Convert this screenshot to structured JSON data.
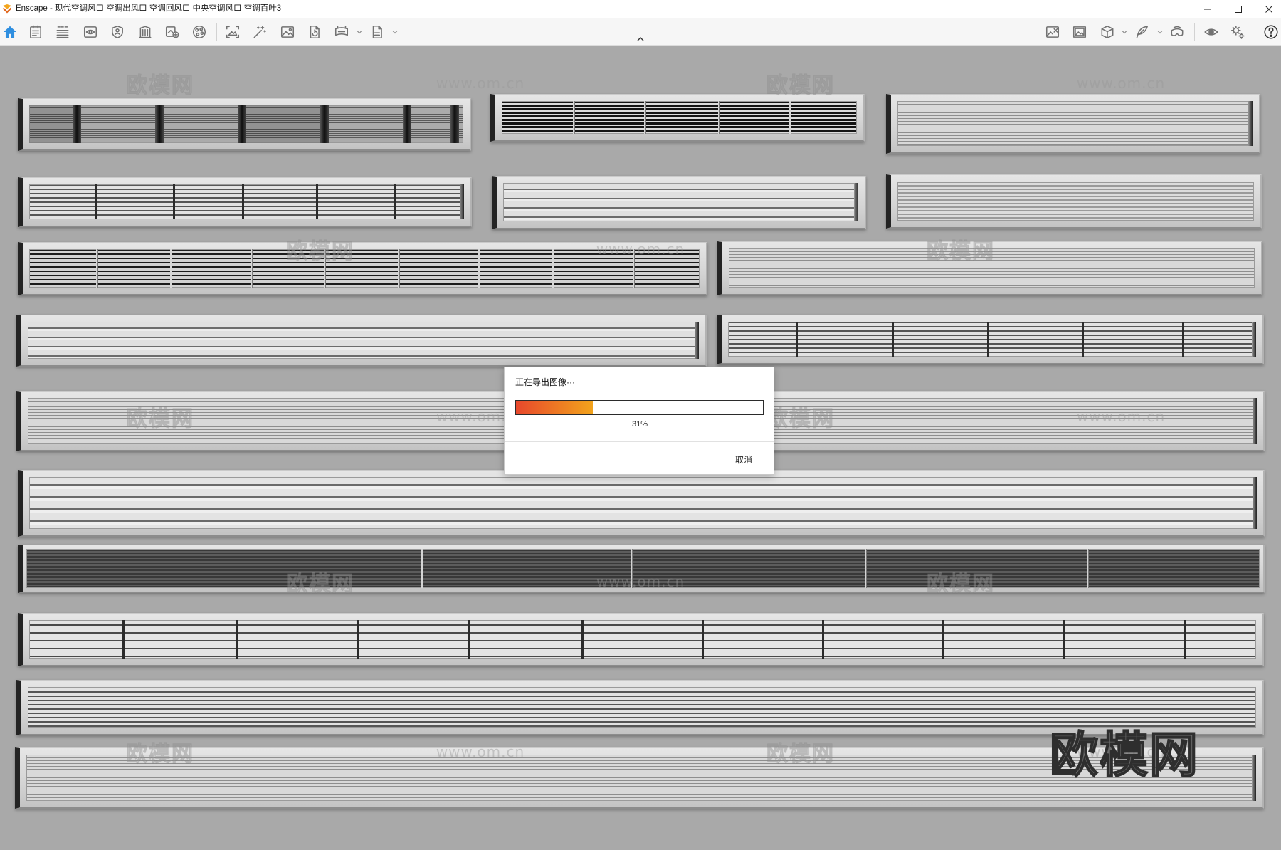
{
  "window": {
    "title": "Enscape - 现代空调风口 空调出风口 空调回风口 中央空调风口 空调百叶3",
    "app_icon": "enscape-logo-icon",
    "controls": [
      "minimize-icon",
      "maximize-icon",
      "close-icon"
    ]
  },
  "toolbar": {
    "accent_color": "#2f8fe0",
    "left_icons": [
      "home-icon",
      "notes-icon",
      "bim-info-icon",
      "view-eye-icon",
      "asset-library-icon",
      "building-icon",
      "add-view-icon",
      "material-palette-icon",
      "screenshot-icon",
      "magic-wand-icon",
      "image-icon",
      "export-document-icon",
      "panorama-icon",
      "chevron-down-icon",
      "exe-export-icon",
      "chevron-down-icon"
    ],
    "right_icons": [
      "site-context-icon",
      "gallery-icon",
      "cube-icon",
      "chevron-down-icon",
      "feather-icon",
      "chevron-down-icon",
      "vr-headset-icon",
      "eye-icon",
      "settings-gear-icon",
      "help-icon"
    ],
    "collapse_icon": "chevron-up-icon"
  },
  "viewport": {
    "background_color": "#a9a9a9",
    "watermark": {
      "logo_text": "欧模网",
      "url_text": "www.om.cn"
    }
  },
  "export_dialog": {
    "title": "正在导出图像···",
    "progress": {
      "value": 0.31,
      "label": "31%"
    },
    "progress_colors": [
      "#e8482c",
      "#f2a31c"
    ],
    "cancel_label": "取消"
  }
}
